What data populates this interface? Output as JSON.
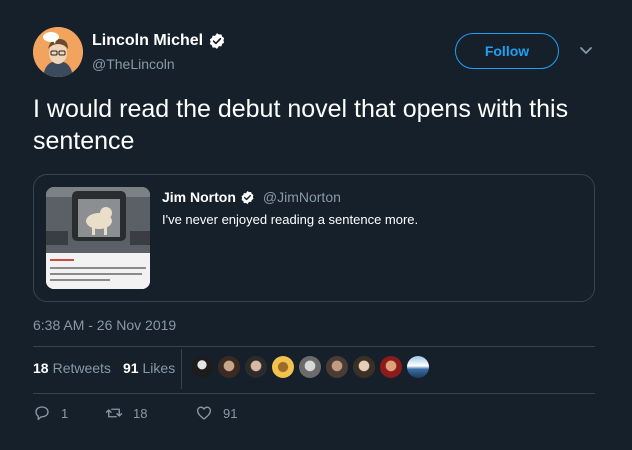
{
  "author": {
    "display_name": "Lincoln Michel",
    "handle": "@TheLincoln",
    "verified": true
  },
  "follow_label": "Follow",
  "tweet_text": "I would read the debut novel that opens with this sentence",
  "quoted": {
    "display_name": "Jim Norton",
    "handle": "@JimNorton",
    "text": "I've never enjoyed reading a sentence more."
  },
  "timestamp": "6:38 AM - 26 Nov 2019",
  "stats": {
    "retweets_count": "18",
    "retweets_label": "Retweets",
    "likes_count": "91",
    "likes_label": "Likes"
  },
  "actions": {
    "reply_count": "1",
    "retweet_count": "18",
    "like_count": "91"
  },
  "colors": {
    "background": "#15202b",
    "accent": "#1da1f2",
    "muted": "#8899a6",
    "border": "#38444d"
  }
}
